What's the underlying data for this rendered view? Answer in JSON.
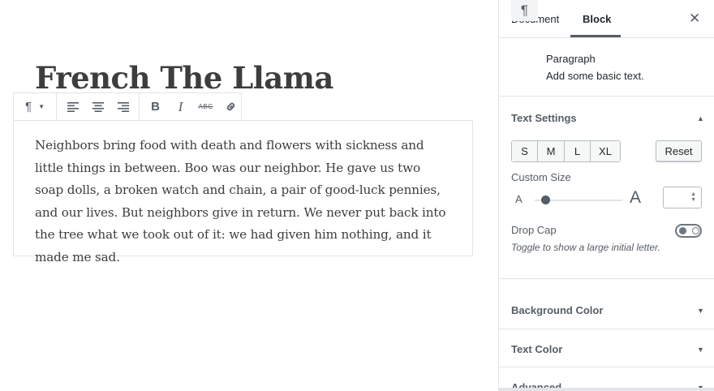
{
  "editor": {
    "title": "French The Llama",
    "paragraph": "Neighbors bring food with death and flowers with sickness and little things in between. Boo was our neighbor. He gave us two soap dolls, a broken watch and chain, a pair of good-luck pennies, and our lives. But neighbors give in return. We never put back into the tree what we took out of it: we had given him nothing, and it made me sad.",
    "toolbar": {
      "block_type_icon": "pilcrow-icon",
      "align": [
        "align-left-icon",
        "align-center-icon",
        "align-right-icon"
      ],
      "bold_label": "B",
      "italic_label": "I",
      "strikethrough_label": "ABC",
      "link_icon": "link-icon"
    }
  },
  "sidebar": {
    "tabs": [
      {
        "label": "Document",
        "active": false
      },
      {
        "label": "Block",
        "active": true
      }
    ],
    "close_icon": "close-icon",
    "block_card": {
      "icon": "pilcrow-icon",
      "title": "Paragraph",
      "description": "Add some basic text."
    },
    "text_settings": {
      "title": "Text Settings",
      "expanded": true,
      "sizes": [
        "S",
        "M",
        "L",
        "XL"
      ],
      "reset_label": "Reset",
      "custom_size_label": "Custom Size",
      "small_a": "A",
      "big_a": "A",
      "slider_value": 0.08,
      "custom_size_value": "",
      "drop_cap_label": "Drop Cap",
      "drop_cap_on": false,
      "drop_cap_help": "Toggle to show a large initial letter."
    },
    "panels": [
      {
        "title": "Background Color",
        "expanded": false
      },
      {
        "title": "Text Color",
        "expanded": false
      },
      {
        "title": "Advanced",
        "expanded": false
      }
    ]
  },
  "colors": {
    "text": "#23282d",
    "muted": "#555d66",
    "border": "#e2e4e7"
  }
}
